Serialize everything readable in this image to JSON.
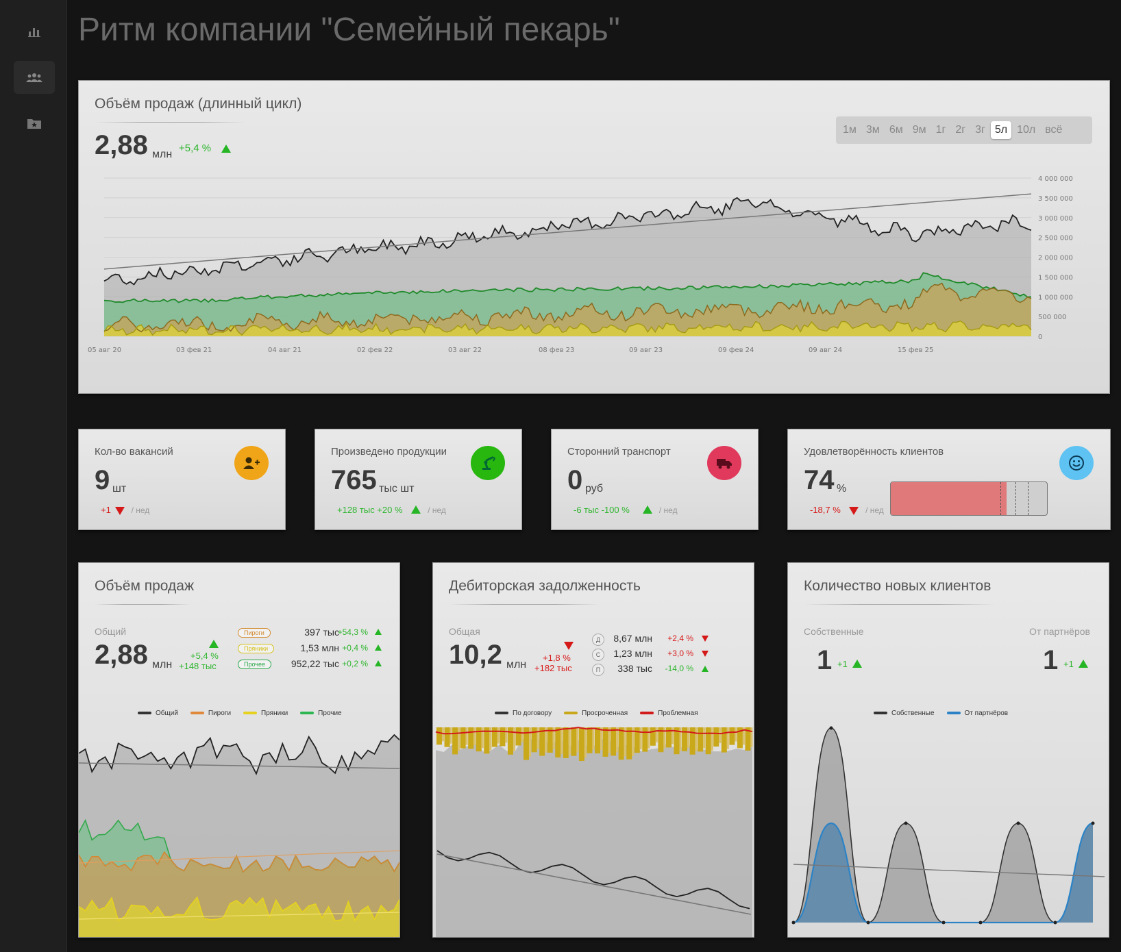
{
  "page_title": "Ритм компании \"Семейный пекарь\"",
  "sidebar": {
    "items": [
      {
        "name": "bar-chart-icon"
      },
      {
        "name": "users-icon"
      },
      {
        "name": "folder-star-icon"
      }
    ]
  },
  "long_cycle": {
    "title": "Объём продаж (длинный цикл)",
    "value": "2,88",
    "unit": "млн",
    "delta": "+5,4 %",
    "periods": [
      "1м",
      "3м",
      "6м",
      "9м",
      "1г",
      "2г",
      "3г",
      "5л",
      "10л",
      "всё"
    ],
    "active_period": "5л",
    "y_ticks": [
      "4 000 000",
      "3 500 000",
      "3 000 000",
      "2 500 000",
      "2 000 000",
      "1 500 000",
      "1 000 000",
      "500 000",
      "0"
    ],
    "x_ticks": [
      "05 авг 20",
      "03 фев 21",
      "04 авг 21",
      "02 фев 22",
      "03 авг 22",
      "08 фев 23",
      "09 авг 23",
      "09 фев 24",
      "09 авг 24",
      "15 фев 25"
    ]
  },
  "kpis": [
    {
      "title": "Кол-во вакансий",
      "value": "9",
      "unit": "шт",
      "delta": "+1",
      "delta_color": "red",
      "dir": "down",
      "per": "/ нед",
      "icon": "user-plus-icon",
      "icon_color": "#f0a417"
    },
    {
      "title": "Произведено продукции",
      "value": "765",
      "unit": "тыс шт",
      "delta": "+128 тыс +20 %",
      "delta_color": "green",
      "dir": "up",
      "per": "/ нед",
      "icon": "robot-arm-icon",
      "icon_color": "#27b70f"
    },
    {
      "title": "Сторонний транспорт",
      "value": "0",
      "unit": "руб",
      "delta": "-6 тыс -100 %",
      "delta_color": "green",
      "dir": "up",
      "per": "/ нед",
      "icon": "truck-icon",
      "icon_color": "#e0395c"
    },
    {
      "title": "Удовлетворённость клиентов",
      "value": "74",
      "unit": "%",
      "delta": "-18,7 %",
      "delta_color": "red",
      "dir": "down",
      "per": "/ нед",
      "icon": "smile-icon",
      "icon_color": "#5ec3f2",
      "gauge_fraction": 0.74
    }
  ],
  "sales": {
    "title": "Объём продаж",
    "label": "Общий",
    "value": "2,88",
    "unit": "млн",
    "delta_pct": "+5,4 %",
    "delta_abs": "+148 тыс",
    "rows": [
      {
        "badge": "Пироги",
        "value": "397 тыс",
        "delta": "+54,3 %",
        "color": "#d28a2e"
      },
      {
        "badge": "Пряники",
        "value": "1,53 млн",
        "delta": "+0,4 %",
        "color": "#d6c21a"
      },
      {
        "badge": "Прочее",
        "value": "952,22 тыс",
        "delta": "+0,2 %",
        "color": "#2aa84a"
      }
    ],
    "legend": [
      {
        "label": "Общий",
        "color": "#333333"
      },
      {
        "label": "Пироги",
        "color": "#e0883a"
      },
      {
        "label": "Пряники",
        "color": "#e6d21e"
      },
      {
        "label": "Прочие",
        "color": "#2db652"
      }
    ]
  },
  "debt": {
    "title": "Дебиторская задолженность",
    "label": "Общая",
    "value": "10,2",
    "unit": "млн",
    "delta_pct": "+1,8 %",
    "delta_abs": "+182 тыс",
    "rows": [
      {
        "badge": "Д",
        "value": "8,67 млн",
        "delta": "+2,4 %"
      },
      {
        "badge": "С",
        "value": "1,23 млн",
        "delta": "+3,0 %"
      },
      {
        "badge": "П",
        "value": "338 тыс",
        "delta": "-14,0 %"
      }
    ],
    "legend": [
      {
        "label": "По договору",
        "color": "#333333"
      },
      {
        "label": "Просроченная",
        "color": "#c8a81a"
      },
      {
        "label": "Проблемная",
        "color": "#d21a1a"
      }
    ]
  },
  "clients": {
    "title": "Количество новых клиентов",
    "own_label": "Собственные",
    "own_value": "1",
    "own_delta": "+1",
    "partner_label": "От партнёров",
    "partner_value": "1",
    "partner_delta": "+1",
    "legend": [
      {
        "label": "Собственные",
        "color": "#333333"
      },
      {
        "label": "От партнёров",
        "color": "#2b83c6"
      }
    ]
  }
}
